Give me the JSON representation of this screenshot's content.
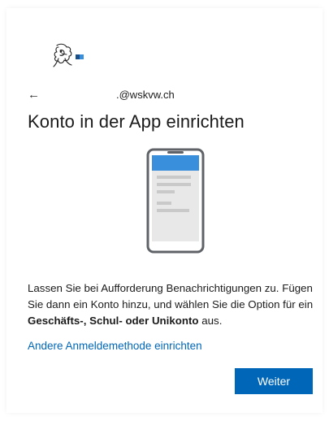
{
  "header": {
    "back_arrow": "←",
    "email_suffix": ".@wskvw.ch"
  },
  "main": {
    "title": "Konto in der App einrichten",
    "description_part1": "Lassen Sie bei Aufforderung Benachrichtigungen zu. Fügen Sie dann ein Konto hinzu, und wählen Sie die Option für ein ",
    "description_bold": "Geschäfts-, Schul- oder Unikonto",
    "description_part2": " aus.",
    "alt_method_link": "Andere Anmeldemethode einrichten",
    "next_button": "Weiter"
  },
  "icons": {
    "logo": "canton-lion-logo",
    "back": "back-arrow-icon",
    "illustration": "phone-illustration"
  },
  "colors": {
    "accent": "#0067b8",
    "phone_top": "#3a8fdd",
    "phone_frame": "#5f6368"
  }
}
